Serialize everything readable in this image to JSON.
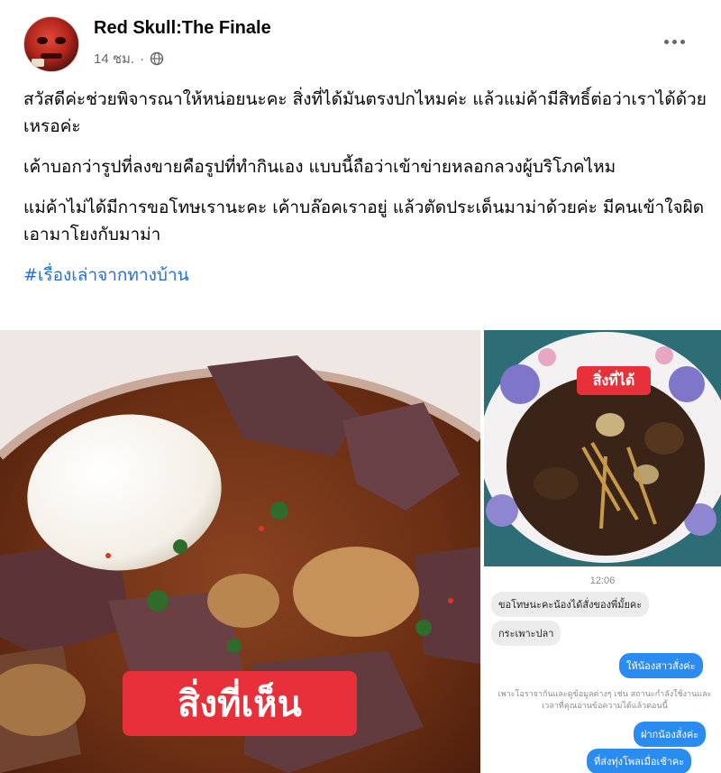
{
  "post": {
    "author": "Red Skull:The Finale",
    "time": "14 ชม.",
    "separator": "·",
    "paragraphs": [
      "สวัสดีค่ะช่วยพิจารณาให้หน่อยนะคะ สิ่งที่ได้มันตรงปกไหมค่ะ  แล้วแม่ค้ามีสิทธิ์ต่อว่าเราได้ด้วยเหรอค่ะ",
      "เค้าบอกว่ารูปที่ลงขายคือรูปที่ทำกินเอง แบบนี้ถือว่าเข้าข่ายหลอกลวงผู้บริโภคไหม",
      "แม่ค้าไม่ได้มีการขอโทษเรานะคะ เค้าบล๊อคเราอยู่ แล้วตัดประเด็นมาม่าด้วยค่ะ มีคนเข้าใจผิดเอามาโยงกับมาม่า"
    ],
    "hashtag": "#เรื่องเล่าจากทางบ้าน"
  },
  "photos": {
    "left_label": "สิ่งที่เห็น",
    "right_top_label": "สิ่งที่ได้"
  },
  "chat": {
    "time": "12:06",
    "messages": [
      {
        "side": "in",
        "text": "ขอโทษนะคะน้องได้สั่งของพี่มั้ยคะ"
      },
      {
        "side": "in",
        "text": "กระเพาะปลา"
      },
      {
        "side": "out",
        "text": "ให้น้องสาวสั่งค่ะ"
      },
      {
        "side": "out",
        "text": "ฝากน้องสั่งค่ะ"
      },
      {
        "side": "out",
        "text": "ที่ส่งทุ่งโพลเมื่อเช้าคะ"
      }
    ],
    "system_note": "เพาะโอราจากันและดูข้อมูลต่างๆ เช่น สถานะกำลังใช้งานและเวลาที่คุณอ่านข้อความได้แล้วตอนนี้"
  },
  "colors": {
    "link": "#216fdb",
    "label_red": "#e8303a",
    "chat_blue": "#2b8cf0",
    "meta_gray": "#65676b"
  },
  "icons": {
    "privacy": "globe-icon",
    "menu": "more-options-icon"
  }
}
